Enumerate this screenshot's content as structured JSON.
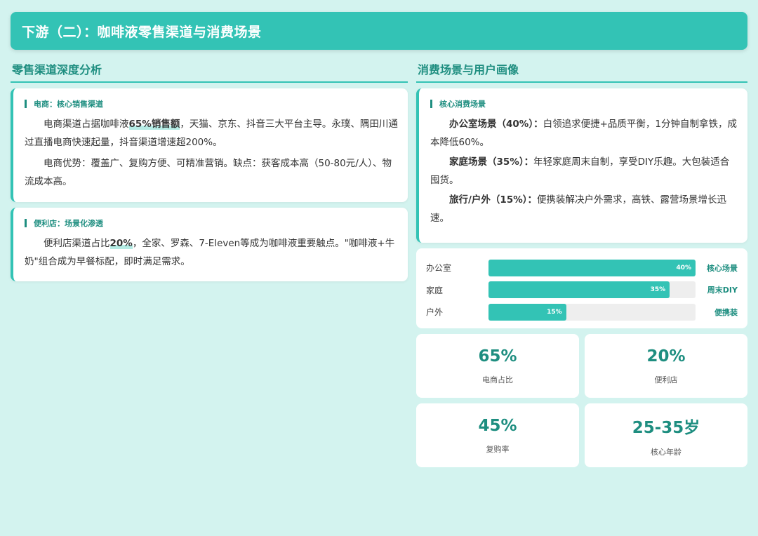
{
  "header": {
    "title": "下游（二）：咖啡液零售渠道与消费场景"
  },
  "left": {
    "section_title": "零售渠道深度分析",
    "ecommerce": {
      "title": "电商：核心销售渠道",
      "p1_a": "电商渠道占据咖啡液",
      "p1_hl": "65%销售额",
      "p1_b": "，天猫、京东、抖音三大平台主导。永璞、隅田川通过直播电商快速起量，抖音渠道增速超200%。",
      "p2": "电商优势：覆盖广、复购方便、可精准营销。缺点：获客成本高（50-80元/人）、物流成本高。"
    },
    "convenience": {
      "title": "便利店：场景化渗透",
      "p1_a": "便利店渠道占比",
      "p1_hl": "20%",
      "p1_b": "，全家、罗森、7-Eleven等成为咖啡液重要触点。\"咖啡液+牛奶\"组合成为早餐标配，即时满足需求。"
    }
  },
  "right": {
    "section_title": "消费场景与用户画像",
    "scenes": {
      "title": "核心消费场景",
      "items": [
        {
          "name": "办公室场景（40%）：",
          "text": "白领追求便捷+品质平衡，1分钟自制拿铁，成本降低60%。"
        },
        {
          "name": "家庭场景（35%）：",
          "text": "年轻家庭周末自制，享受DIY乐趣。大包装适合囤货。"
        },
        {
          "name": "旅行/户外（15%）：",
          "text": "便携装解决户外需求，高铁、露营场景增长迅速。"
        }
      ]
    },
    "bars": [
      {
        "label": "办公室",
        "value": 40,
        "display": "40%",
        "tag": "核心场景"
      },
      {
        "label": "家庭",
        "value": 35,
        "display": "35%",
        "tag": "周末DIY"
      },
      {
        "label": "户外",
        "value": 15,
        "display": "15%",
        "tag": "便携装"
      }
    ],
    "bars_max": 40,
    "stats": [
      {
        "value": "65%",
        "label": "电商占比"
      },
      {
        "value": "20%",
        "label": "便利店"
      },
      {
        "value": "45%",
        "label": "复购率"
      },
      {
        "value": "25-35岁",
        "label": "核心年龄"
      }
    ]
  },
  "colors": {
    "accent": "#33c3b5",
    "accent_dark": "#1e8e80",
    "background": "#d3f3ef"
  }
}
